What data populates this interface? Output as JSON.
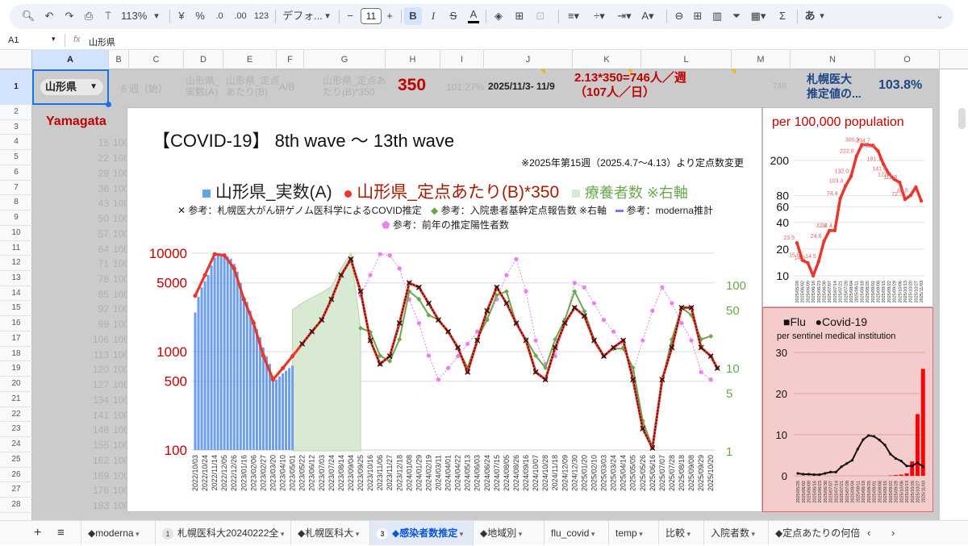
{
  "toolbar": {
    "zoom": "113%",
    "currency": "¥",
    "percent": "%",
    "dec_decrease": ".0",
    "dec_increase": ".00",
    "number_format": "123",
    "font": "デフォ...",
    "font_size": "11",
    "bold": "B",
    "italic": "I",
    "strike": "S",
    "text_color": "A",
    "sigma": "Σ",
    "input_mode": "あ",
    "icons": [
      "search-icon",
      "undo-icon",
      "redo-icon",
      "print-icon",
      "paint-format-icon"
    ]
  },
  "formula_bar": {
    "cell_ref": "A1",
    "fx": "fx",
    "value": "山形県"
  },
  "columns": [
    "A",
    "B",
    "C",
    "D",
    "E",
    "F",
    "G",
    "H",
    "I",
    "J",
    "K",
    "L",
    "M",
    "N",
    "O"
  ],
  "row_numbers": [
    "1",
    "2",
    "3",
    "4",
    "5",
    "6",
    "7",
    "8",
    "9",
    "10",
    "11",
    "12",
    "13",
    "14",
    "15",
    "16",
    "17",
    "18",
    "19",
    "20",
    "21",
    "22",
    "23",
    "24",
    "25",
    "26",
    "27",
    "28"
  ],
  "row1": {
    "a1_dropdown": "山形県",
    "b1": "6 週（始）",
    "d1": "山形県_\n実数(A)",
    "e1": "山形県_定点\nあたり(B)",
    "f1": "A/B",
    "g1": "山形県_定点あ\nたり(B)*350",
    "h1": "350",
    "i1": "101.27%",
    "j1": "2025/11/3- 11/9",
    "k1": "2.13*350=746人／週\n（107人／日）",
    "m1": "746",
    "n1": "札幌医大\n推定値の...",
    "o1": "103.8%"
  },
  "a2": "Yamagata",
  "col_a_values": [
    "15",
    "22",
    "29",
    "36",
    "43",
    "50",
    "57",
    "64",
    "71",
    "78",
    "85",
    "92",
    "99",
    "106",
    "113",
    "120",
    "127",
    "134",
    "141",
    "148",
    "155",
    "162",
    "169",
    "176",
    "183"
  ],
  "col_b_value": "100",
  "scroll_count": "163",
  "colors": {
    "red": "#e8382d",
    "blue": "#6d9eeb",
    "green": "#6aa84f",
    "green_area": "#d9ead3",
    "pink": "#ea7ff0",
    "dark_red": "#c00000",
    "navy": "#1c4587"
  },
  "chart_data": [
    {
      "type": "line",
      "title": "【COVID-19】 8th wave 〜 13th wave",
      "note": "※2025年第15週（2025.4.7〜4.13）より定点数変更",
      "legend": {
        "blue": "山形県_実数(A)",
        "red": "山形県_定点あたり(B)*350",
        "green_area": "療養者数 ※右軸",
        "x_marker": "参考：札幌医大がん研ゲノム医科学によるCOVID推定",
        "green_line": "参考：入院患者基幹定点報告数 ※右軸",
        "moderna": "参考：moderna推計",
        "pink": "参考：前年の推定陽性者数"
      },
      "y_left": {
        "scale": "log",
        "range": [
          100,
          10000
        ],
        "ticks": [
          "10000",
          "5000",
          "1000",
          "500",
          "100"
        ]
      },
      "y_right": {
        "scale": "log",
        "range": [
          1,
          300
        ],
        "ticks": [
          "100",
          "50",
          "10",
          "5",
          "1"
        ]
      },
      "x_labels": [
        "2022/10/03",
        "2022/10/24",
        "2022/11/14",
        "2022/12/05",
        "2022/12/26",
        "2023/01/16",
        "2023/02/06",
        "2023/02/27",
        "2023/03/20",
        "2023/04/10",
        "2023/05/01",
        "2023/05/22",
        "2023/06/12",
        "2023/07/03",
        "2023/07/24",
        "2023/08/14",
        "2023/09/04",
        "2023/09/25",
        "2023/10/16",
        "2023/11/06",
        "2023/11/27",
        "2023/12/18",
        "2024/01/08",
        "2024/01/29",
        "2024/02/19",
        "2024/03/11",
        "2024/04/01",
        "2024/04/22",
        "2024/05/13",
        "2024/06/03",
        "2024/06/24",
        "2024/07/15",
        "2024/08/05",
        "2024/08/26",
        "2024/09/16",
        "2024/10/07",
        "2024/10/28",
        "2024/11/18",
        "2024/12/09",
        "2024/12/30",
        "2025/01/20",
        "2025/02/10",
        "2025/03/03",
        "2025/03/24",
        "2025/04/14",
        "2025/05/05",
        "2025/05/26",
        "2025/06/16",
        "2025/07/07",
        "2025/07/28",
        "2025/08/18",
        "2025/09/08",
        "2025/09/29",
        "2025/10/20"
      ],
      "weeks_per_label": 3,
      "red_series": [
        3700,
        6000,
        9800,
        9500,
        7000,
        3400,
        1950,
        910,
        520,
        680,
        900,
        1200,
        1600,
        2100,
        3400,
        6000,
        8700,
        4100,
        1300,
        750,
        900,
        1950,
        5000,
        4500,
        3100,
        2100,
        1600,
        1100,
        620,
        1300,
        2600,
        4500,
        3100,
        1950,
        1300,
        620,
        520,
        1100,
        1950,
        2800,
        2300,
        1300,
        900,
        1100,
        1300,
        520,
        165,
        105,
        520,
        1100,
        2800,
        2800,
        1100,
        900
      ],
      "red_final_value": 680,
      "blue_bars_weekly": [
        2500,
        3600,
        4500,
        5200,
        6000,
        7500,
        9000,
        9700,
        9800,
        9600,
        9300,
        8800,
        7800,
        6500,
        5000,
        3600,
        3200,
        2600,
        2100,
        1700,
        1400,
        1100,
        900,
        750,
        560,
        520,
        560,
        600,
        640,
        680,
        720
      ],
      "green_area_start_label_index": 10,
      "green_area": [
        50,
        60,
        70,
        80,
        95,
        160,
        240,
        30
      ],
      "green_line_start_label_index": 17,
      "green_line": [
        30,
        27,
        14,
        12,
        22,
        83,
        67,
        43,
        38,
        27,
        17,
        10,
        22,
        38,
        75,
        83,
        34,
        22,
        14,
        10,
        22,
        38,
        83,
        48,
        22,
        14,
        17,
        17,
        10,
        2.3,
        1.1,
        7,
        22,
        53,
        43,
        22,
        24
      ],
      "pink_start_label_index": 17,
      "pink_series": [
        3700,
        6000,
        9800,
        9500,
        7000,
        3400,
        1950,
        910,
        520,
        680,
        900,
        1200,
        1600,
        2100,
        3400,
        6000,
        8700,
        4100,
        1300,
        750,
        900,
        1950,
        5000,
        4500,
        3100,
        2100,
        1600,
        1100,
        620,
        1300,
        2600,
        4500,
        3100,
        1950,
        1300,
        620,
        520
      ],
      "estimate_start_label_index": 11
    },
    {
      "type": "line",
      "title": "per 100,000 population",
      "y_scale": "log",
      "y_ticks": [
        "200",
        "80",
        "60",
        "40",
        "20",
        "10"
      ],
      "x_labels": [
        "2025/05/26",
        "2025/06/02",
        "2025/06/09",
        "2025/06/16",
        "2025/06/23",
        "2025/06/30",
        "2025/07/07",
        "2025/07/14",
        "2025/07/21",
        "2025/07/28",
        "2025/08/04",
        "2025/08/11",
        "2025/08/18",
        "2025/08/25",
        "2025/09/01",
        "2025/09/08",
        "2025/09/15",
        "2025/09/22",
        "2025/09/29",
        "2025/10/06",
        "2025/10/13",
        "2025/10/20",
        "2025/10/27",
        "2025/11/03"
      ],
      "values": [
        23.5,
        15.0,
        14.0,
        10.0,
        14.5,
        24.6,
        32.4,
        32.4,
        74.4,
        103.4,
        132.0,
        222.8,
        300.9,
        300.9,
        294.7,
        255.5,
        181.1,
        141.6,
        122.5,
        112.9,
        72.7,
        80.5,
        100.0,
        70.0
      ],
      "labels": [
        "23.5",
        "15.0",
        "14.0",
        "",
        "14.5",
        "24.6",
        "32.4",
        "32.4",
        "74.4",
        "103.4",
        "132.0",
        "222.8",
        "300.9",
        "",
        "294.7",
        "255.5",
        "181.1",
        "141.6",
        "122.5",
        "112.9",
        "72.7",
        "80.5",
        "",
        ""
      ]
    },
    {
      "type": "bar",
      "legend": {
        "flu": "■Flu",
        "covid": "●Covid-19"
      },
      "subtitle": "per sentinel medical institution",
      "y_range": [
        0,
        30
      ],
      "y_ticks": [
        "30",
        "20",
        "10",
        "0"
      ],
      "x_labels_ref": "same as per 100,000 population",
      "covid": [
        0.6,
        0.4,
        0.4,
        0.3,
        0.3,
        0.6,
        0.9,
        0.9,
        2.2,
        3.0,
        3.8,
        6.5,
        8.8,
        9.8,
        9.6,
        8.7,
        7.5,
        5.3,
        4.2,
        3.6,
        2.4,
        2.4,
        3.2,
        2.2
      ],
      "flu": [
        0,
        0,
        0,
        0,
        0,
        0,
        0,
        0,
        0,
        0,
        0,
        0,
        0,
        0,
        0,
        0,
        0,
        0.1,
        0.2,
        0.3,
        0.6,
        3.5,
        15,
        26
      ]
    }
  ],
  "tabs": [
    {
      "label": "◆moderna"
    },
    {
      "label": "札幌医科大20240222全",
      "badge": "1"
    },
    {
      "label": "◆札幌医科大"
    },
    {
      "label": "◆感染者数推定",
      "badge": "3",
      "active": true
    },
    {
      "label": "◆地域別"
    },
    {
      "label": "flu_covid"
    },
    {
      "label": "temp"
    },
    {
      "label": "比較"
    },
    {
      "label": "入院者数"
    },
    {
      "label": "◆定点あたりの何倍"
    }
  ]
}
